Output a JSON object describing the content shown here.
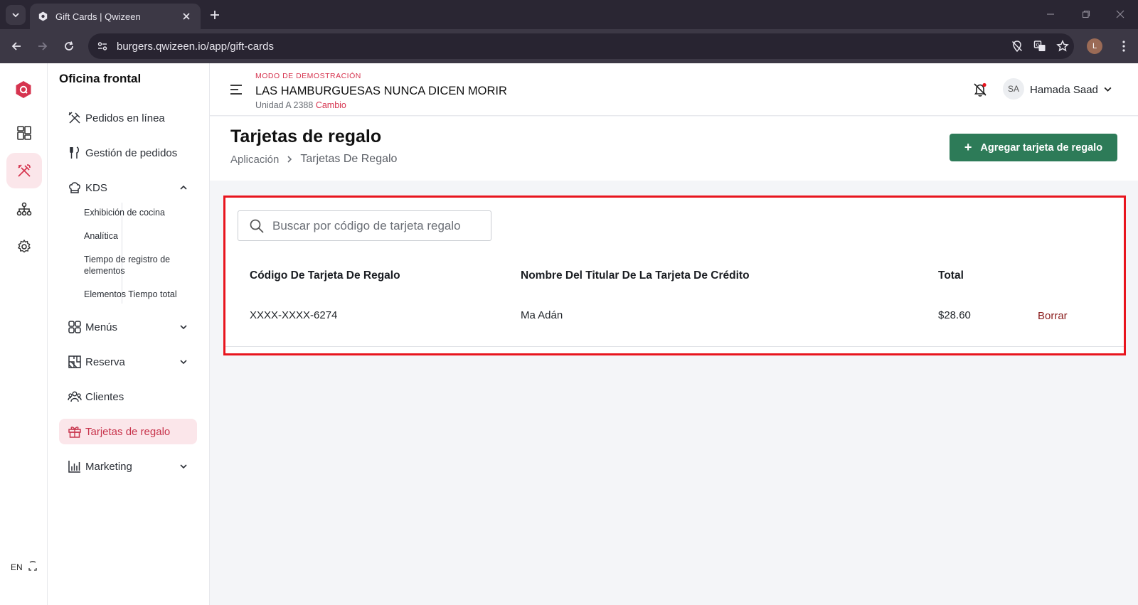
{
  "browser": {
    "tab_title": "Gift Cards | Qwizeen",
    "url": "burgers.qwizeen.io/app/gift-cards",
    "profile_initial": "L"
  },
  "rail": {
    "language": "EN"
  },
  "sidebar": {
    "title": "Oficina frontal",
    "items": [
      {
        "label": "Pedidos en línea",
        "icon": "fork-knife-crossed-icon"
      },
      {
        "label": "Gestión de pedidos",
        "icon": "utensils-icon"
      },
      {
        "label": "KDS",
        "icon": "chef-hat-icon",
        "expanded": true
      },
      {
        "label": "Menús",
        "icon": "grid-icon"
      },
      {
        "label": "Reserva",
        "icon": "floor-plan-icon"
      },
      {
        "label": "Clientes",
        "icon": "users-icon"
      },
      {
        "label": "Tarjetas de regalo",
        "icon": "gift-icon",
        "active": true
      },
      {
        "label": "Marketing",
        "icon": "bar-chart-icon"
      }
    ],
    "kds_sub": [
      "Exhibición de cocina",
      "Analítica",
      "Tiempo de registro de elementos",
      "Elementos Tiempo total"
    ]
  },
  "topbar": {
    "demo_mode": "MODO DE DEMOSTRACIÓN",
    "restaurant": "LAS HAMBURGUESAS NUNCA DICEN MORIR",
    "unit": "Unidad A 2388",
    "change": "Cambio",
    "avatar_initials": "SA",
    "user_name": "Hamada Saad"
  },
  "page": {
    "title": "Tarjetas de regalo",
    "breadcrumb": [
      "Aplicación",
      "Tarjetas De Regalo"
    ],
    "add_button": "Agregar tarjeta de regalo"
  },
  "giftcards": {
    "search_placeholder": "Buscar por código de tarjeta regalo",
    "columns": [
      "Código De Tarjeta De Regalo",
      "Nombre Del Titular De La Tarjeta De Crédito",
      "Total"
    ],
    "rows": [
      {
        "code": "XXXX-XXXX-6274",
        "holder": "Ma Adán",
        "total": "$28.60",
        "action": "Borrar"
      }
    ]
  },
  "colors": {
    "accent": "#d6344f",
    "primary_button": "#2d7b58",
    "highlight_border": "#e8151e"
  }
}
